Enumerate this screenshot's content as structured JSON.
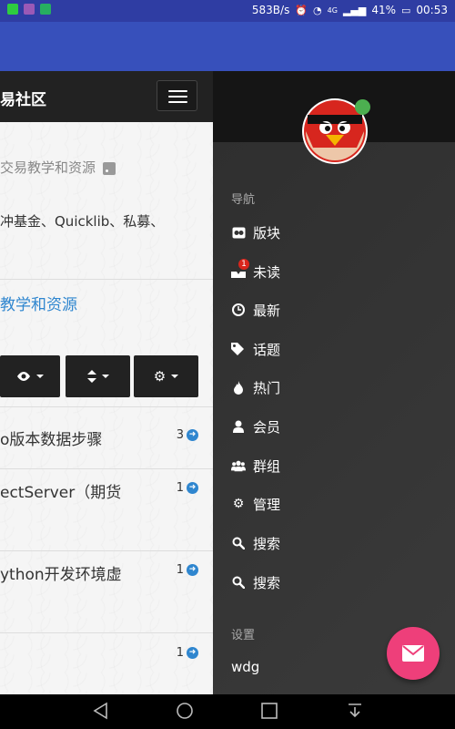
{
  "status_bar": {
    "speed": "583B/s",
    "network": "4G",
    "battery": "41%",
    "time": "00:53",
    "app_icon_colors": [
      "#2ecc40",
      "#9b59b6",
      "#27ae60"
    ]
  },
  "site": {
    "title": "易社区"
  },
  "breadcrumb": {
    "text": "交易教学和资源"
  },
  "category": {
    "description": "冲基金、Quicklib、私募、",
    "link_text": "教学和资源"
  },
  "toolbar": {
    "buttons": [
      {
        "icon": "eye-icon"
      },
      {
        "icon": "sort-icon"
      },
      {
        "icon": "gear-icon"
      }
    ]
  },
  "topics": [
    {
      "title": "o版本数据步骤",
      "count": "3"
    },
    {
      "title": "ectServer（期货",
      "count": "1"
    },
    {
      "title": "ython开发环境虚",
      "count": "1"
    },
    {
      "title": "",
      "count": "1"
    }
  ],
  "drawer": {
    "nav_section": "导航",
    "items": [
      {
        "label": "版块",
        "icon": "categories-icon"
      },
      {
        "label": "未读",
        "icon": "unread-icon",
        "badge": "1"
      },
      {
        "label": "最新",
        "icon": "clock-icon"
      },
      {
        "label": "话题",
        "icon": "tags-icon"
      },
      {
        "label": "热门",
        "icon": "fire-icon"
      },
      {
        "label": "会员",
        "icon": "user-icon"
      },
      {
        "label": "群组",
        "icon": "group-icon"
      },
      {
        "label": "管理",
        "icon": "cogs-icon"
      },
      {
        "label": "搜索",
        "icon": "search-icon"
      },
      {
        "label": "搜索",
        "icon": "search-icon"
      }
    ],
    "settings_section": "设置",
    "username": "wdg"
  },
  "colors": {
    "app_bar": "#3750bb",
    "accent_link": "#2f86cf",
    "fab": "#ee3f7a",
    "online": "#4caf50"
  }
}
